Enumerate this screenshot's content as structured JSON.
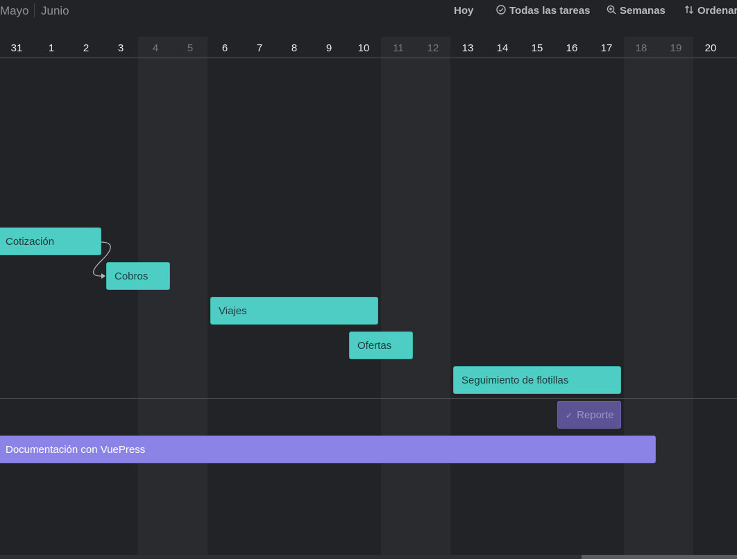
{
  "header": {
    "prev_month": "Mayo",
    "current_month": "Junio",
    "today_button": "Hoy",
    "filter_button": "Todas las tareas",
    "zoom_button": "Semanas",
    "sort_button": "Ordenar"
  },
  "days": [
    "31",
    "1",
    "2",
    "3",
    "4",
    "5",
    "6",
    "7",
    "8",
    "9",
    "10",
    "11",
    "12",
    "13",
    "14",
    "15",
    "16",
    "17",
    "18",
    "19",
    "20"
  ],
  "tasks": [
    {
      "label": "Cotización"
    },
    {
      "label": "Cobros"
    },
    {
      "label": "Viajes"
    },
    {
      "label": "Ofertas"
    },
    {
      "label": "Seguimiento de flotillas"
    },
    {
      "label": "Reporte",
      "completed": true
    },
    {
      "label": "Documentación con VuePress"
    }
  ],
  "colors": {
    "background": "#222326",
    "weekend": "#2a2b2e",
    "task_teal": "#4ecdc4",
    "task_purple": "#8b84e6",
    "task_done": "#5b5394"
  }
}
